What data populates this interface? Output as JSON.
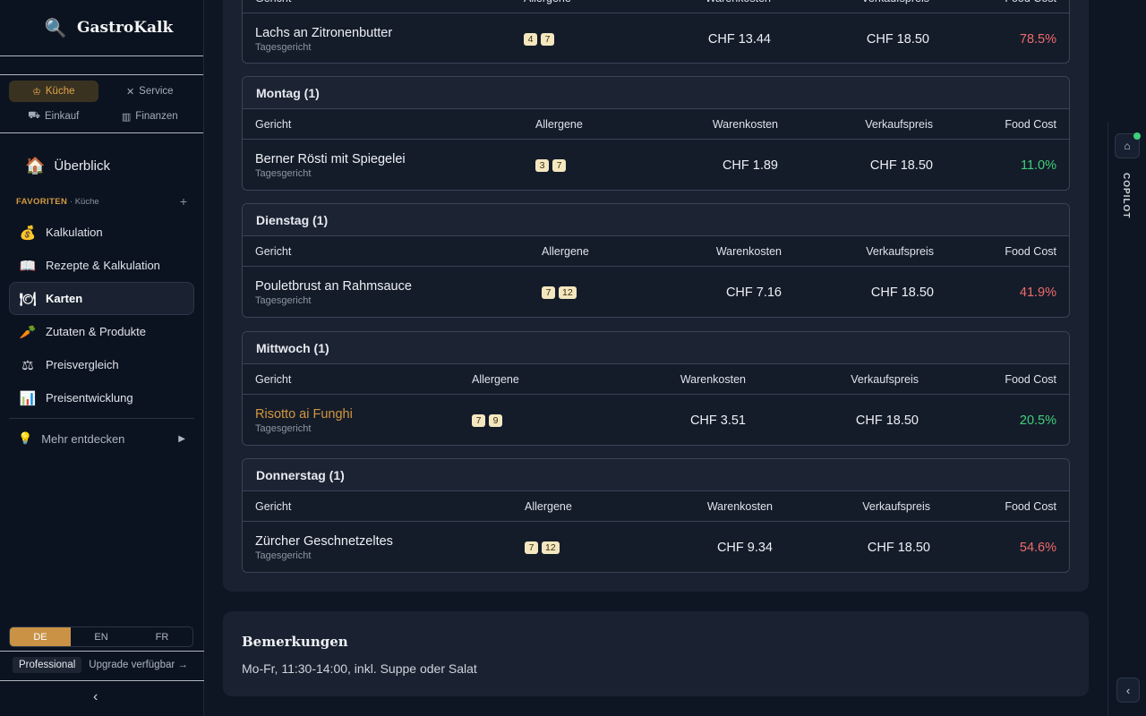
{
  "app": {
    "name": "GastroKalk"
  },
  "departments": [
    {
      "icon": "chef-hat-icon",
      "label": "Küche",
      "active": true
    },
    {
      "icon": "utensils-icon",
      "label": "Service",
      "active": false
    },
    {
      "icon": "cart-icon",
      "label": "Einkauf",
      "active": false
    },
    {
      "icon": "chart-icon",
      "label": "Finanzen",
      "active": false
    }
  ],
  "nav": {
    "overview": "Überblick",
    "favorites_label": "FAVORITEN",
    "favorites_sub": "· Küche",
    "add": "+",
    "items": [
      {
        "label": "Kalkulation",
        "icon": "money-bag-icon"
      },
      {
        "label": "Rezepte & Kalkulation",
        "icon": "book-icon"
      },
      {
        "label": "Karten",
        "icon": "plate-icon",
        "active": true
      },
      {
        "label": "Zutaten & Produkte",
        "icon": "carrot-icon"
      },
      {
        "label": "Preisvergleich",
        "icon": "scale-icon"
      },
      {
        "label": "Preisentwicklung",
        "icon": "bar-chart-icon"
      }
    ],
    "more": "Mehr entdecken"
  },
  "languages": [
    {
      "label": "DE",
      "active": true
    },
    {
      "label": "EN",
      "active": false
    },
    {
      "label": "FR",
      "active": false
    }
  ],
  "plan": {
    "badge": "Professional",
    "upgrade": "Upgrade verfügbar →"
  },
  "copilot": {
    "label": "COPILOT"
  },
  "columns": {
    "dish": "Gericht",
    "allergens": "Allergene",
    "cost": "Warenkosten",
    "price": "Verkaufspreis",
    "food_cost": "Food Cost"
  },
  "top_row": {
    "name": "Lachs an Zitronenbutter",
    "sub": "Tagesgericht",
    "allergens": [
      "4",
      "7"
    ],
    "cost": "CHF 13.44",
    "price": "CHF 18.50",
    "food_cost": "78.5%",
    "status": "red"
  },
  "days": [
    {
      "title": "Montag (1)",
      "rows": [
        {
          "name": "Berner Rösti mit Spiegelei",
          "sub": "Tagesgericht",
          "allergens": [
            "3",
            "7"
          ],
          "cost": "CHF 1.89",
          "price": "CHF 18.50",
          "food_cost": "11.0%",
          "status": "green"
        }
      ]
    },
    {
      "title": "Dienstag (1)",
      "rows": [
        {
          "name": "Pouletbrust an Rahmsauce",
          "sub": "Tagesgericht",
          "allergens": [
            "7",
            "12"
          ],
          "cost": "CHF 7.16",
          "price": "CHF 18.50",
          "food_cost": "41.9%",
          "status": "red"
        }
      ]
    },
    {
      "title": "Mittwoch (1)",
      "rows": [
        {
          "name": "Risotto ai Funghi",
          "sub": "Tagesgericht",
          "allergens": [
            "7",
            "9"
          ],
          "cost": "CHF 3.51",
          "price": "CHF 18.50",
          "food_cost": "20.5%",
          "status": "green",
          "highlight": true
        }
      ]
    },
    {
      "title": "Donnerstag (1)",
      "rows": [
        {
          "name": "Zürcher Geschnetzeltes",
          "sub": "Tagesgericht",
          "allergens": [
            "7",
            "12"
          ],
          "cost": "CHF 9.34",
          "price": "CHF 18.50",
          "food_cost": "54.6%",
          "status": "red"
        }
      ]
    }
  ],
  "remarks": {
    "title": "Bemerkungen",
    "text": "Mo-Fr, 11:30-14:00, inkl. Suppe oder Salat"
  }
}
